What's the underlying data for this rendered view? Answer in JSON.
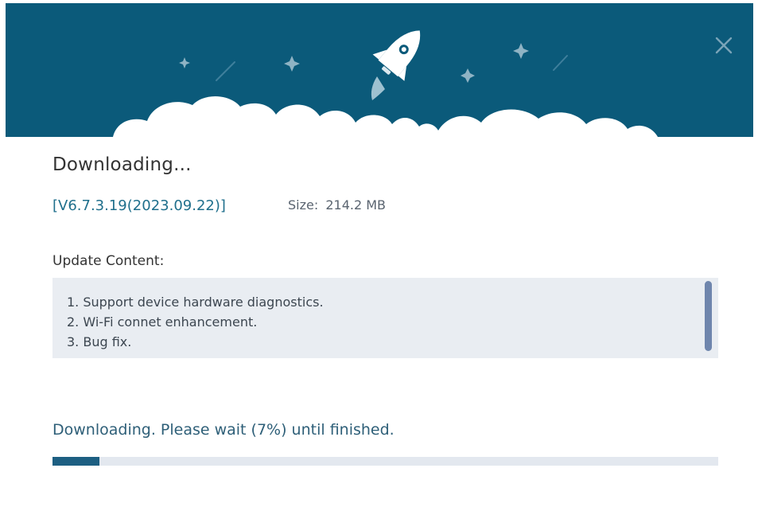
{
  "colors": {
    "banner_background": "#0b5a7a",
    "accent": "#1d5f82",
    "version_link": "#1f6f8c",
    "progress_track": "#e3e8ef",
    "content_background": "#e9edf2"
  },
  "banner": {
    "icon": "rocket-icon",
    "decorations": [
      "sparkle-icon",
      "shooting-star-line",
      "cloud-shape"
    ]
  },
  "dialog": {
    "close_icon": "close-icon",
    "title": "Downloading...",
    "version": "[V6.7.3.19(2023.09.22)]",
    "size_label": "Size:",
    "size_value": "214.2 MB",
    "update_content_label": "Update Content:",
    "update_items": [
      "1. Support device hardware diagnostics.",
      "2. Wi-Fi connet enhancement.",
      "3. Bug fix."
    ],
    "status_text": "Downloading. Please wait (7%) until finished.",
    "progress_percent": 7
  }
}
